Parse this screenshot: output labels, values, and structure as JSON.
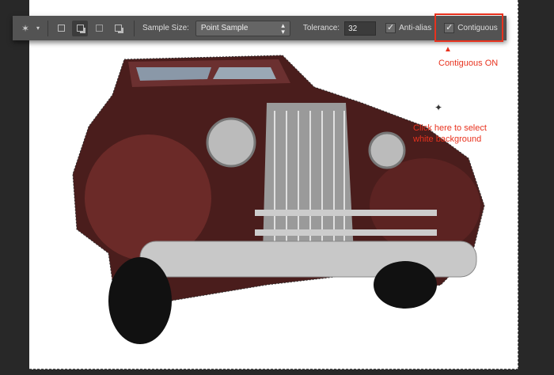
{
  "toolbar": {
    "tool": "magic-wand",
    "sample_size_label": "Sample Size:",
    "sample_size_value": "Point Sample",
    "tolerance_label": "Tolerance:",
    "tolerance_value": "32",
    "anti_alias_label": "Anti-alias",
    "anti_alias_checked": true,
    "contiguous_label": "Contiguous",
    "contiguous_checked": true
  },
  "annotations": {
    "contiguous": "Contiguous ON",
    "click_line1": "Click here to select",
    "click_line2": "white background"
  },
  "colors": {
    "accent": "#e8321e",
    "car": "#5a2220"
  }
}
